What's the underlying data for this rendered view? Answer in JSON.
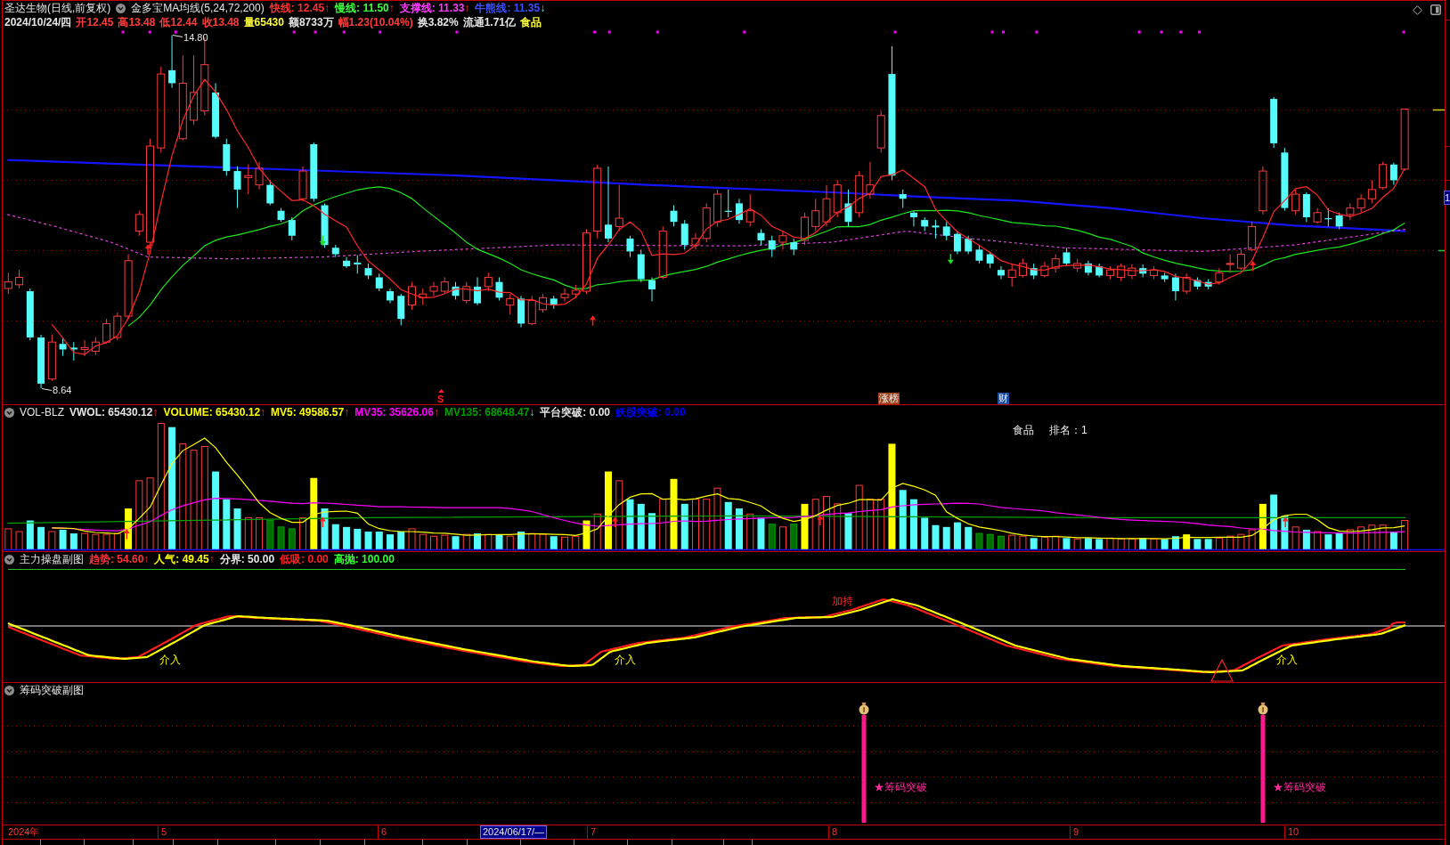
{
  "window": {
    "title": "圣达生物(日线,前复权)"
  },
  "price_panel": {
    "indicator": "金多宝MA均线(5,24,72,200)",
    "values": [
      {
        "text": "快线: 12.45",
        "arrow": "↑",
        "rising": true,
        "color": "#ff3232"
      },
      {
        "text": "慢线: 11.50",
        "arrow": "↑",
        "rising": true,
        "color": "#3cff3c"
      },
      {
        "text": "支撑线: 11.33",
        "arrow": "↑",
        "rising": true,
        "color": "#ff3cff"
      },
      {
        "text": "牛熊线: 11.35",
        "arrow": "↓",
        "rising": false,
        "color": "#3c50ff"
      }
    ],
    "quote": [
      {
        "text": "2024/10/24/四",
        "color": "#e6e6e6"
      },
      {
        "text": "开12.45",
        "color": "#ff3c3c"
      },
      {
        "text": "高13.48",
        "color": "#ff3c3c"
      },
      {
        "text": "低12.44",
        "color": "#ff3c3c"
      },
      {
        "text": "收13.48",
        "color": "#ff3c3c"
      },
      {
        "text": "量65430",
        "color": "#ffff3c"
      },
      {
        "text": "额8733万",
        "color": "#e6e6e6"
      },
      {
        "text": "幅1.23(10.04%)",
        "color": "#ff3c3c"
      },
      {
        "text": "换3.82%",
        "color": "#e6e6e6"
      },
      {
        "text": "流通1.71亿",
        "color": "#e6e6e6"
      },
      {
        "text": "食品",
        "color": "#ffff3c"
      }
    ],
    "high_label": "14.80",
    "low_label": "8.64",
    "markers": [
      {
        "text": "S",
        "kind": "letter",
        "color": "#ff2020"
      },
      {
        "text": "涨榜",
        "kind": "badge",
        "color": "#a0461e"
      },
      {
        "text": "财",
        "kind": "badge",
        "color": "#1e4ea0"
      }
    ],
    "price_tag": "1"
  },
  "volume_panel": {
    "name": "VOL-BLZ",
    "values": [
      {
        "text": "VWOL: 65430.12",
        "arrow": "↑",
        "rising": true,
        "color": "#e6e6e6"
      },
      {
        "text": "VOLUME: 65430.12",
        "arrow": "↑",
        "rising": true,
        "color": "#ffff00"
      },
      {
        "text": "MV5: 49586.57",
        "arrow": "↑",
        "rising": true,
        "color": "#ffff00"
      },
      {
        "text": "MV35: 35626.06",
        "arrow": "↑",
        "rising": true,
        "color": "#ff00ff"
      },
      {
        "text": "MV135: 68648.47",
        "arrow": "↓",
        "rising": false,
        "color": "#00a000"
      },
      {
        "text": "平台突破: 0.00",
        "color": "#e6e6e6"
      },
      {
        "text": "妖股突破: 0.00",
        "color": "#0000ff"
      }
    ],
    "sector": "食品",
    "rank": "排名：1"
  },
  "trend_panel": {
    "name": "主力操盘副图",
    "values": [
      {
        "text": "趋势: 54.60",
        "arrow": "↑",
        "rising": true,
        "color": "#ff3232"
      },
      {
        "text": "人气: 49.45",
        "arrow": "↑",
        "rising": true,
        "color": "#ffff00"
      },
      {
        "text": "分界: 50.00",
        "color": "#e6e6e6"
      },
      {
        "text": "低吸: 0.00",
        "color": "#ff2020"
      },
      {
        "text": "高抛: 100.00",
        "color": "#32ff32"
      }
    ],
    "signals": [
      {
        "text": "介入",
        "kind": "buy"
      },
      {
        "text": "介入",
        "kind": "buy"
      },
      {
        "text": "加持",
        "kind": "hold"
      },
      {
        "text": "介入",
        "kind": "buy"
      }
    ]
  },
  "chip_panel": {
    "name": "筹码突破副图",
    "signals": [
      {
        "text": "★筹码突破"
      },
      {
        "text": "★筹码突破"
      }
    ]
  },
  "time_axis": [
    {
      "text": "2024年",
      "highlighted": false
    },
    {
      "text": "5",
      "highlighted": false
    },
    {
      "text": "6",
      "highlighted": false
    },
    {
      "text": "2024/06/17/—",
      "highlighted": true
    },
    {
      "text": "7",
      "highlighted": false
    },
    {
      "text": "8",
      "highlighted": false
    },
    {
      "text": "9",
      "highlighted": false
    },
    {
      "text": "10",
      "highlighted": false
    }
  ]
}
